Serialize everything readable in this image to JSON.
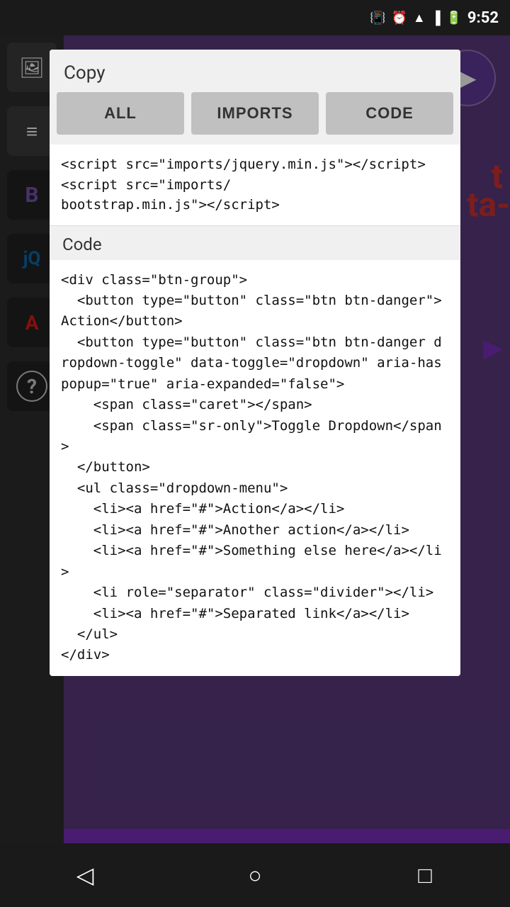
{
  "statusBar": {
    "time": "9:52",
    "icons": [
      "vibrate",
      "alarm",
      "wifi",
      "signal",
      "battery"
    ]
  },
  "dialog": {
    "title": "Copy",
    "tabs": [
      {
        "id": "all",
        "label": "ALL"
      },
      {
        "id": "imports",
        "label": "IMPORTS"
      },
      {
        "id": "code",
        "label": "CODE"
      }
    ],
    "importsCode": "<script src=\"imports/jquery.min.js\"></script>\n<script src=\"imports/\nbootstrap.min.js\"></script>",
    "codeSectionLabel": "Code",
    "codeText": "<div class=\"btn-group\">\n  <button type=\"button\" class=\"btn btn-danger\">Action</button>\n  <button type=\"button\" class=\"btn btn-danger dropdown-toggle\" data-toggle=\"dropdown\" aria-haspopup=\"true\" aria-expanded=\"false\">\n    <span class=\"caret\"></span>\n    <span class=\"sr-only\">Toggle Dropdown</span>\n  </button>\n  <ul class=\"dropdown-menu\">\n    <li><a href=\"#\">Action</a></li>\n    <li><a href=\"#\">Another action</a></li>\n    <li><a href=\"#\">Something else here</a></li>\n    <li role=\"separator\" class=\"divider\"></li>\n    <li><a href=\"#\">Separated link</a></li>\n  </ul>\n</div>"
  },
  "sidebar": {
    "items": [
      {
        "label": "image",
        "icon": "🖼"
      },
      {
        "label": "menu",
        "icon": "≡"
      },
      {
        "label": "bootstrap",
        "icon": "B"
      },
      {
        "label": "jquery",
        "icon": "j"
      },
      {
        "label": "angular",
        "icon": "A"
      },
      {
        "label": "help",
        "icon": "?"
      }
    ]
  },
  "bottomNav": {
    "back": "◁",
    "home": "○",
    "recent": "□"
  }
}
